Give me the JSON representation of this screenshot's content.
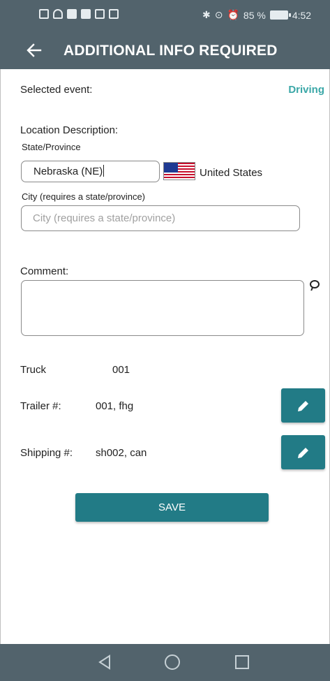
{
  "status_bar": {
    "battery": "85 %",
    "time": "4:52"
  },
  "app_bar": {
    "title": "ADDITIONAL INFO REQUIRED"
  },
  "form": {
    "selected_event_label": "Selected event:",
    "selected_event_value": "Driving",
    "location_label": "Location Description:",
    "state_label": "State/Province",
    "state_value": "Nebraska (NE)",
    "country_name": "United States",
    "city_label": "City (requires a state/province)",
    "city_placeholder": "City (requires a state/province)",
    "comment_label": "Comment:",
    "comment_value": "",
    "truck_label": "Truck",
    "truck_value": "001",
    "trailer_label": "Trailer #:",
    "trailer_value": "001, fhg",
    "shipping_label": "Shipping #:",
    "shipping_value": "sh002, can",
    "save_label": "SAVE"
  },
  "colors": {
    "bar": "#52636c",
    "accent": "#227b86",
    "event_value": "#3aa7a7"
  }
}
